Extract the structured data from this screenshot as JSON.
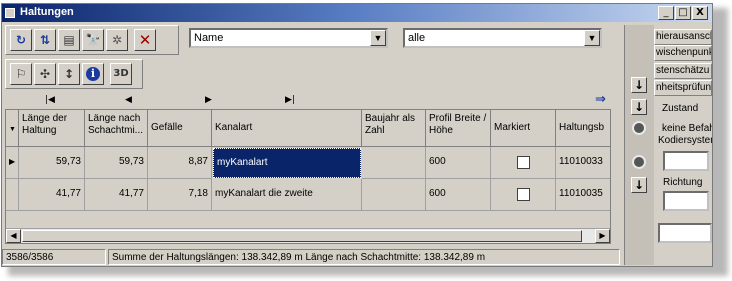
{
  "window": {
    "title": "Haltungen"
  },
  "titlebar_buttons": {
    "minimize": "_",
    "maximize": "□",
    "close": "X"
  },
  "toolbar": {
    "field_combo": {
      "value": "Name",
      "arrow": "▼"
    },
    "filter_combo": {
      "value": "alle",
      "arrow": "▼"
    },
    "info_glyph": "i",
    "delete_glyph": "✕",
    "binocular_glyph": "🔭",
    "text3d_glyph": "3D"
  },
  "navigation": {
    "first": "|◀",
    "prev": "◀",
    "next": "▶",
    "last": "▶|",
    "jump": "⇒"
  },
  "table": {
    "columns": [
      "Länge der Haltung",
      "Länge nach Schachtmi...",
      "Gefälle",
      "Kanalart",
      "Baujahr als Zahl",
      "Profil Breite / Höhe",
      "Markiert",
      "Haltungsb"
    ],
    "rows": [
      {
        "laenge": "59,73",
        "laenge_schacht": "59,73",
        "gefaelle": "8,87",
        "kanalart": "myKanalart",
        "baujahr": "",
        "profil": "600",
        "markiert": false,
        "haltung": "11010033"
      },
      {
        "laenge": "41,77",
        "laenge_schacht": "41,77",
        "gefaelle": "7,18",
        "kanalart": "myKanalart die zweite",
        "baujahr": "",
        "profil": "600",
        "markiert": false,
        "haltung": "11010035"
      }
    ],
    "selected_row_marker": "▶"
  },
  "status": {
    "count": "3586/3586",
    "summary": "Summe der Haltungslängen: 138.342,89 m  Länge nach Schachtmitte: 138.342,89 m"
  },
  "sidepanel": {
    "tabs": [
      "hierausansch",
      "wischenpunk",
      "stenschätzu",
      "nheitsprüfun"
    ],
    "zustand_label": "Zustand",
    "befahrung_label": "keine Befahrung",
    "kodiersystem_label": "Kodiersystem",
    "richtung_label": "Richtung",
    "arrows": {
      "down": "↓"
    }
  }
}
